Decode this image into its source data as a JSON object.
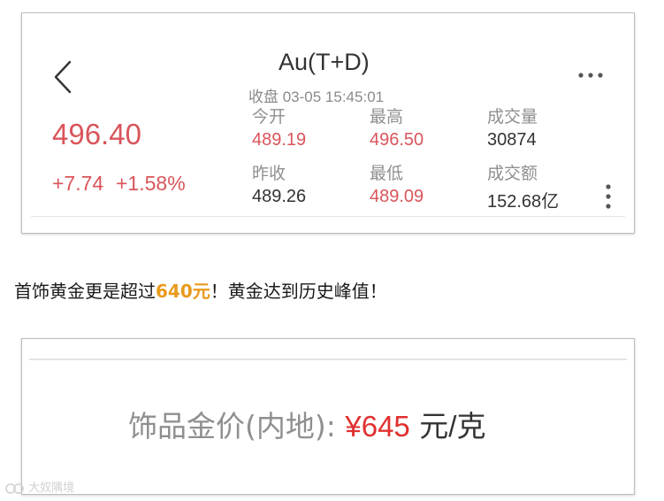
{
  "header": {
    "symbol": "Au(T+D)",
    "status": "收盘 03-05 15:45:01"
  },
  "quote": {
    "price": "496.40",
    "change": "+7.74",
    "change_pct": "+1.58%"
  },
  "stats": {
    "open": {
      "label": "今开",
      "value": "489.19"
    },
    "high": {
      "label": "最高",
      "value": "496.50"
    },
    "volume": {
      "label": "成交量",
      "value": "30874"
    },
    "prev_close": {
      "label": "昨收",
      "value": "489.26"
    },
    "low": {
      "label": "最低",
      "value": "489.09"
    },
    "turnover": {
      "label": "成交额",
      "value": "152.68亿"
    }
  },
  "headline": {
    "before": "首饰黄金更是超过",
    "highlight": "640元",
    "after": "！黄金达到历史峰值！"
  },
  "jewelry": {
    "label": "饰品金价(内地):",
    "price": "¥645",
    "unit": "元/克"
  },
  "watermark": "大奴隅境",
  "icons": {
    "back": "chevron-left-icon",
    "more": "more-horizontal-icon",
    "kebab": "more-vertical-icon"
  },
  "colors": {
    "up_red": "#d9555b",
    "price_red": "#e0302f",
    "highlight_orange": "#e89a1d"
  }
}
